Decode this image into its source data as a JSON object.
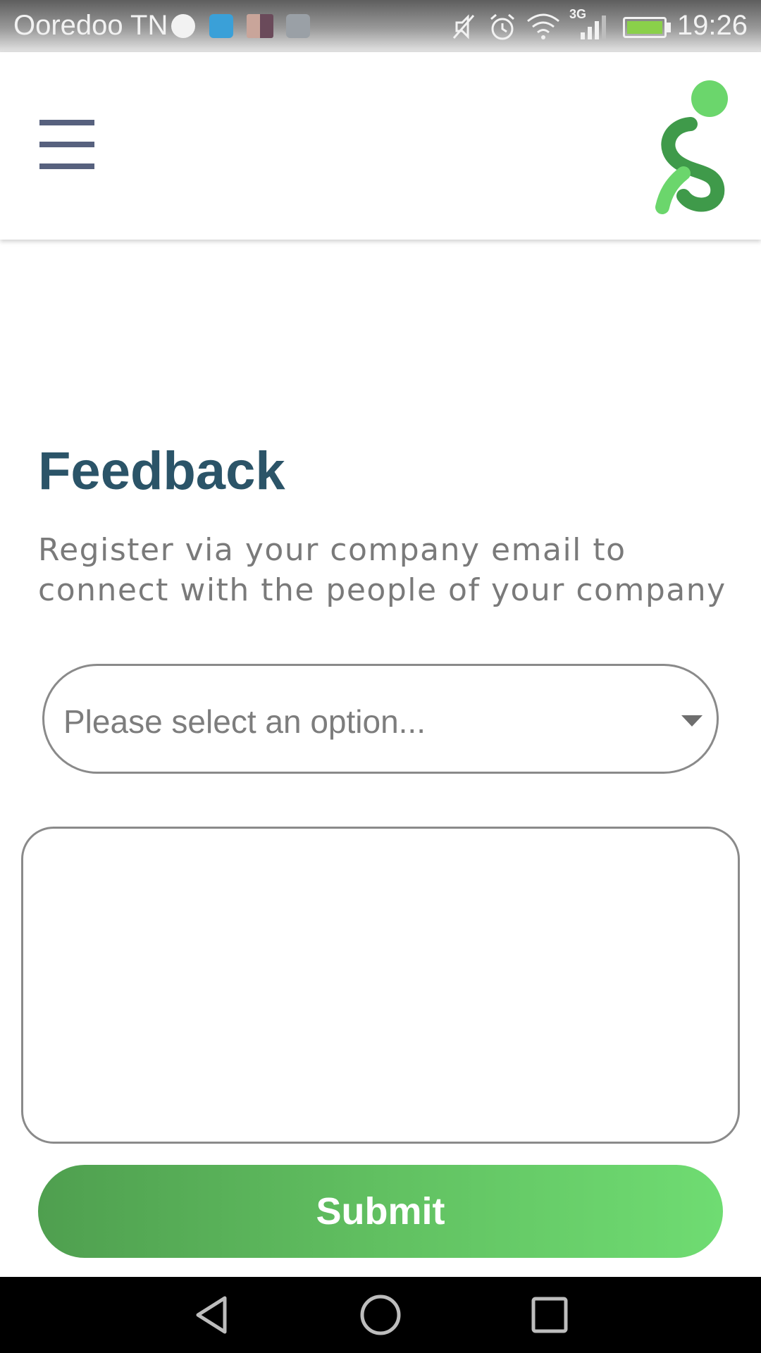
{
  "status_bar": {
    "carrier": "Ooredoo TN",
    "time": "19:26",
    "network": "3G",
    "icons": [
      "app-notification-icon",
      "usb-icon",
      "photo-notification-icon",
      "gallery-icon",
      "mute-icon",
      "alarm-icon",
      "wifi-icon",
      "signal-icon",
      "battery-charging-icon"
    ]
  },
  "header": {
    "menu_icon": "hamburger-menu-icon",
    "logo_icon": "app-logo",
    "brand_colors": {
      "dark_green": "#3f9a4a",
      "light_green": "#6bd66c"
    }
  },
  "main": {
    "title": "Feedback",
    "subtitle": "Register via your company email to connect with the people of your company",
    "select": {
      "placeholder": "Please select an option..."
    },
    "message": {
      "value": "",
      "placeholder": ""
    },
    "submit_label": "Submit"
  },
  "nav_bar": {
    "icons": [
      "back-icon",
      "home-icon",
      "recents-icon"
    ]
  },
  "colors": {
    "title": "#2b5468",
    "subtitle": "#7a7a7a",
    "border": "#8a8a8a",
    "menu": "#57617e",
    "button_gradient_start": "#4f9f4f",
    "button_gradient_end": "#6fdc72"
  }
}
